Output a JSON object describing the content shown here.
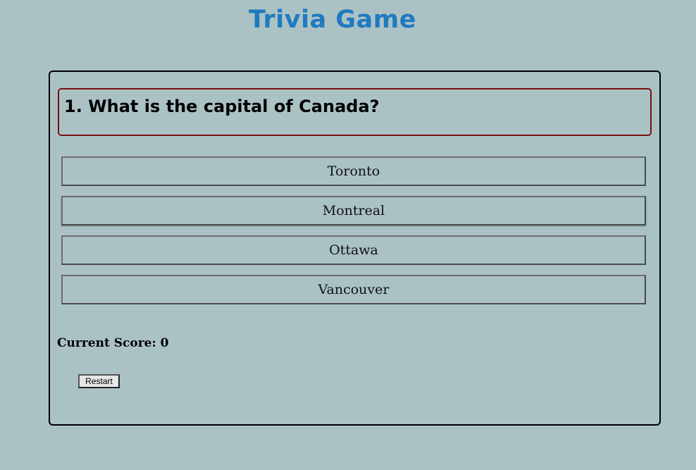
{
  "app": {
    "title": "Trivia Game"
  },
  "question": {
    "text": "1. What is the capital of Canada?"
  },
  "answers": [
    {
      "label": "Toronto"
    },
    {
      "label": "Montreal"
    },
    {
      "label": "Ottawa"
    },
    {
      "label": "Vancouver"
    }
  ],
  "score": {
    "text": "Current Score: 0"
  },
  "controls": {
    "restart_label": "Restart"
  },
  "colors": {
    "background": "#abc2c5",
    "title": "#1f7ac0",
    "question_border": "#7a0f12"
  }
}
